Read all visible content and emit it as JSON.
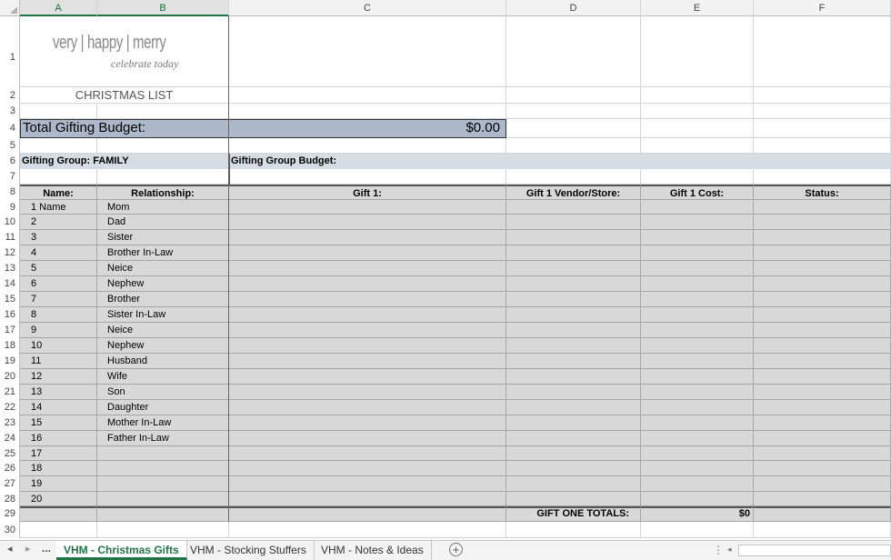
{
  "columns": [
    "A",
    "B",
    "C",
    "D",
    "E",
    "F"
  ],
  "rows_numbers": [
    "1",
    "2",
    "3",
    "4",
    "5",
    "6",
    "7",
    "8",
    "9",
    "10",
    "11",
    "12",
    "13",
    "14",
    "15",
    "16",
    "17",
    "18",
    "19",
    "20",
    "21",
    "22",
    "23",
    "24",
    "25",
    "26",
    "27",
    "28",
    "29",
    "30"
  ],
  "logo": {
    "main": "very | happy | merry",
    "tagline": "celebrate today"
  },
  "sheet": {
    "title": "CHRISTMAS LIST",
    "budget_label": "Total Gifting Budget:",
    "budget_value": "$0.00",
    "group_label": "Gifting Group: FAMILY",
    "group_budget_label": "Gifting Group Budget:",
    "headers": {
      "name": "Name:",
      "relationship": "Relationship:",
      "gift": "Gift 1:",
      "vendor": "Gift 1 Vendor/Store:",
      "cost": "Gift 1 Cost:",
      "status": "Status:"
    },
    "rows": [
      {
        "name": "1 Name",
        "rel": "Mom"
      },
      {
        "name": "2",
        "rel": "Dad"
      },
      {
        "name": "3",
        "rel": "Sister"
      },
      {
        "name": "4",
        "rel": "Brother In-Law"
      },
      {
        "name": "5",
        "rel": "Neice"
      },
      {
        "name": "6",
        "rel": "Nephew"
      },
      {
        "name": "7",
        "rel": "Brother"
      },
      {
        "name": "8",
        "rel": "Sister In-Law"
      },
      {
        "name": "9",
        "rel": "Neice"
      },
      {
        "name": "10",
        "rel": "Nephew"
      },
      {
        "name": "11",
        "rel": "Husband"
      },
      {
        "name": "12",
        "rel": "Wife"
      },
      {
        "name": "13",
        "rel": "Son"
      },
      {
        "name": "14",
        "rel": "Daughter"
      },
      {
        "name": "15",
        "rel": "Mother In-Law"
      },
      {
        "name": "16",
        "rel": "Father In-Law"
      },
      {
        "name": "17",
        "rel": ""
      },
      {
        "name": "18",
        "rel": ""
      },
      {
        "name": "19",
        "rel": ""
      },
      {
        "name": "20",
        "rel": ""
      }
    ],
    "totals_label": "GIFT ONE TOTALS:",
    "totals_value": "$0"
  },
  "tabs": {
    "nav_prev": "◂",
    "nav_next": "▸",
    "more": "...",
    "items": [
      "VHM - Christmas Gifts",
      "VHM - Stocking Stuffers",
      "VHM - Notes & Ideas"
    ],
    "add": "+"
  },
  "colors": {
    "accent": "#217346",
    "budget_bg": "#adb9ca",
    "cell_gray": "#d8d8d8",
    "group_bg": "#d6dce4"
  }
}
